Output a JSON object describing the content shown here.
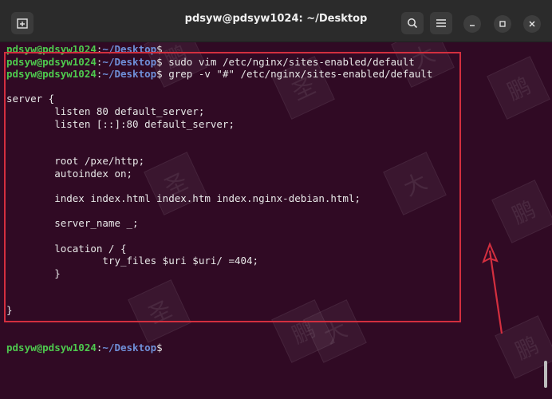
{
  "window": {
    "title": "pdsyw@pdsyw1024: ~/Desktop"
  },
  "prompt": {
    "user_host": "pdsyw@pdsyw1024",
    "sep": ":",
    "path": "~/Desktop",
    "symbol": "$"
  },
  "commands": [
    " sudo vim /etc/nginx/sites-enabled/default",
    " grep -v \"#\" /etc/nginx/sites-enabled/default"
  ],
  "output": [
    "",
    "server {",
    "        listen 80 default_server;",
    "        listen [::]:80 default_server;",
    "",
    "",
    "        root /pxe/http;",
    "        autoindex on;",
    "",
    "        index index.html index.htm index.nginx-debian.html;",
    "",
    "        server_name _;",
    "",
    "        location / {",
    "                try_files $uri $uri/ =404;",
    "        }",
    "",
    "",
    "}",
    "",
    ""
  ],
  "watermark_char": "鹏",
  "watermark_char2": "大",
  "watermark_char3": "圣",
  "colors": {
    "background": "#300a24",
    "prompt_user": "#4ec94e",
    "prompt_path": "#6f8fd8",
    "highlight": "#d32f3f"
  },
  "icons": {
    "new_tab": "new-tab-icon",
    "search": "search-icon",
    "menu": "hamburger-menu-icon",
    "minimize": "minimize-icon",
    "maximize": "maximize-icon",
    "close": "close-icon",
    "arrow": "red-arrow"
  }
}
